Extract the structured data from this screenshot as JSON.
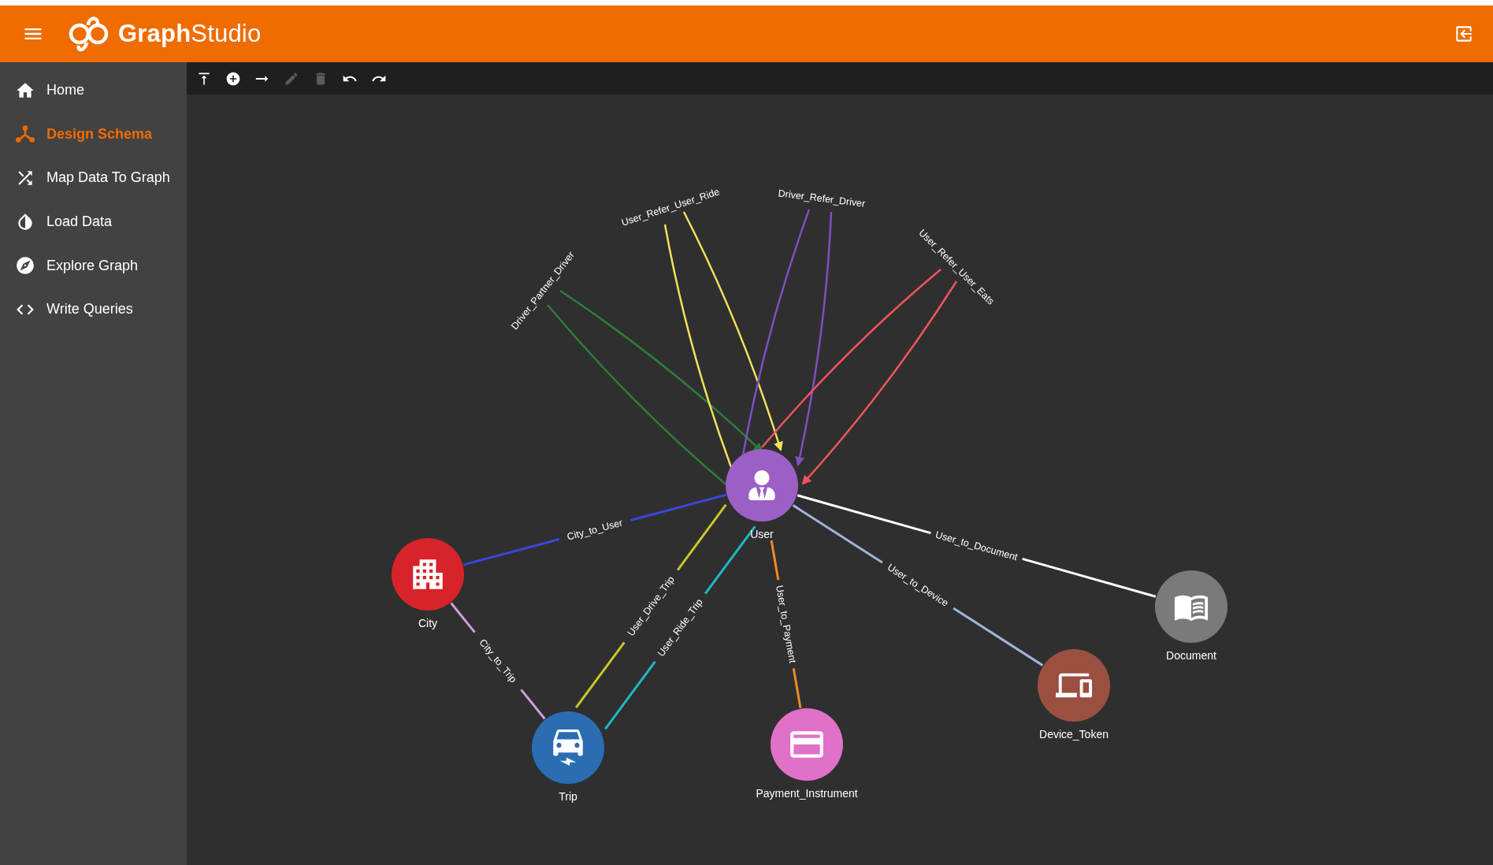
{
  "header": {
    "title": "**Graph**Studio"
  },
  "sidebar": {
    "items": [
      {
        "label": "Home",
        "selected": false
      },
      {
        "label": "Design Schema",
        "selected": true
      },
      {
        "label": "Map Data To Graph",
        "selected": false
      },
      {
        "label": "Load Data",
        "selected": false
      },
      {
        "label": "Explore Graph",
        "selected": false
      },
      {
        "label": "Write Queries",
        "selected": false
      }
    ]
  },
  "toolbar": [
    {
      "kind": "publish",
      "disabled": false
    },
    {
      "kind": "add",
      "disabled": false
    },
    {
      "kind": "edge",
      "disabled": false
    },
    {
      "kind": "edit",
      "disabled": true
    },
    {
      "kind": "delete",
      "disabled": true
    },
    {
      "kind": "undo",
      "disabled": false
    },
    {
      "kind": "redo",
      "disabled": false
    }
  ],
  "graph": {
    "nodes": [
      {
        "label": "User",
        "color": "#9b5fc6"
      },
      {
        "label": "City",
        "color": "#d8232a"
      },
      {
        "label": "Trip",
        "color": "#2a6db3"
      },
      {
        "label": "Payment_Instrument",
        "color": "#e071c8"
      },
      {
        "label": "Device_Token",
        "color": "#9a5040"
      },
      {
        "label": "Document",
        "color": "#7a7a7a"
      }
    ],
    "edges": [
      {
        "label": "City_to_User",
        "color": "#3a45e0"
      },
      {
        "label": "City_to_Trip",
        "color": "#c9a0dc"
      },
      {
        "label": "User_Drive_Trip",
        "color": "#c8c82a"
      },
      {
        "label": "User_Ride_Trip",
        "color": "#1fb8c8"
      },
      {
        "label": "User_to_Payment",
        "color": "#f08a24"
      },
      {
        "label": "User_to_Device",
        "color": "#9fb4dc"
      },
      {
        "label": "User_to_Document",
        "color": "#ffffff"
      }
    ],
    "loops": [
      {
        "label": "Driver_Partner_Driver",
        "color": "#2e7d3a"
      },
      {
        "label": "User_Refer_User_Ride",
        "color": "#f3e05a"
      },
      {
        "label": "Driver_Refer_Driver",
        "color": "#7e4fc0"
      },
      {
        "label": "User_Refer_User_Eats",
        "color": "#f0545a"
      }
    ]
  }
}
